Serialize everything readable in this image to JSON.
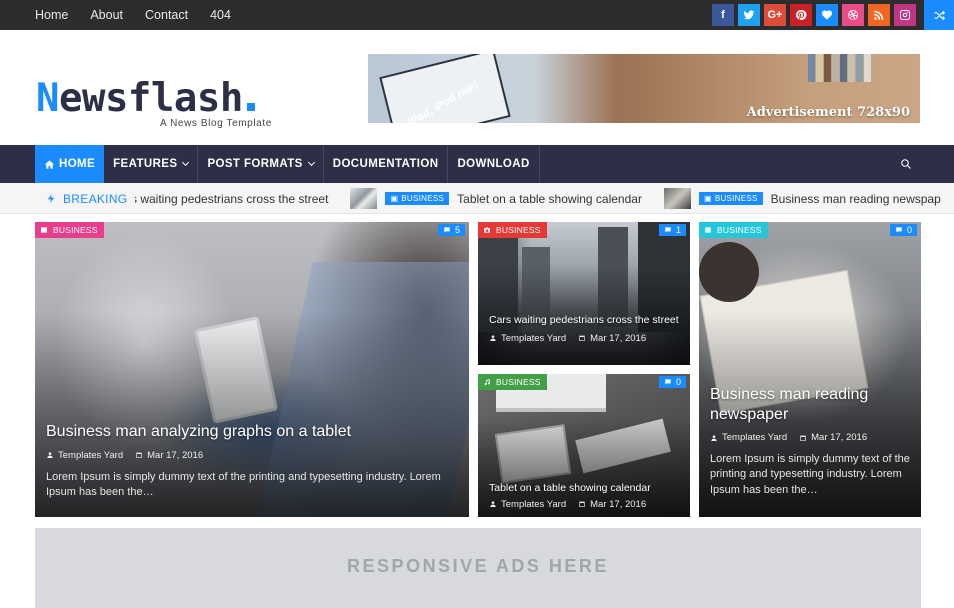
{
  "topnav": {
    "items": [
      "Home",
      "About",
      "Contact",
      "404"
    ]
  },
  "socials": [
    {
      "icon": "facebook-icon",
      "glyph": "f",
      "color": "#3b5998"
    },
    {
      "icon": "twitter-icon",
      "glyph": "t",
      "color": "#1da1f2"
    },
    {
      "icon": "google-plus-icon",
      "glyph": "G+",
      "color": "#dd4b39"
    },
    {
      "icon": "pinterest-icon",
      "glyph": "P",
      "color": "#cb2027"
    },
    {
      "icon": "heart-icon",
      "glyph": "♥",
      "color": "#1a8cff"
    },
    {
      "icon": "dribbble-icon",
      "glyph": "◎",
      "color": "#ea4c89"
    },
    {
      "icon": "rss-icon",
      "glyph": "◉",
      "color": "#f26522"
    },
    {
      "icon": "instagram-icon",
      "glyph": "◻",
      "color": "#c13584"
    }
  ],
  "logo": {
    "first": "N",
    "rest": "ewsflash",
    "tagline": "A News Blog Template"
  },
  "ad": {
    "text": "Advertisement 728x90",
    "ipad_label": "iPad, iPod mini"
  },
  "mainnav": {
    "home": "HOME",
    "features": "FEATURES",
    "post_formats": "POST FORMATS",
    "documentation": "DOCUMENTATION",
    "download": "DOWNLOAD"
  },
  "ticker": {
    "label": "BREAKING",
    "items": [
      {
        "title": "s waiting pedestrians cross the street"
      },
      {
        "badge": "BUSINESS",
        "title": "Tablet on a table showing calendar"
      },
      {
        "badge": "BUSINESS",
        "title": "Business man reading newspap"
      }
    ]
  },
  "posts": [
    {
      "category": "BUSINESS",
      "category_color": "#e83e8c",
      "comments": "5",
      "title": "Business man analyzing graphs on a tablet",
      "author": "Templates Yard",
      "date": "Mar 17, 2016",
      "excerpt": "Lorem Ipsum is simply dummy text of the printing and typesetting industry. Lorem Ipsum has been the…"
    },
    {
      "category": "BUSINESS",
      "category_color": "#e53935",
      "comments": "1",
      "title": "Cars waiting pedestrians cross the street",
      "author": "Templates Yard",
      "date": "Mar 17, 2016"
    },
    {
      "category": "BUSINESS",
      "category_color": "#43a047",
      "comments": "0",
      "title": "Tablet on a table showing calendar",
      "author": "Templates Yard",
      "date": "Mar 17, 2016"
    },
    {
      "category": "BUSINESS",
      "category_color": "#26c6da",
      "comments": "0",
      "title": "Business man reading newspaper",
      "author": "Templates Yard",
      "date": "Mar 17, 2016",
      "excerpt": "Lorem Ipsum is simply dummy text of the printing and typesetting industry. Lorem Ipsum has been the…"
    }
  ],
  "ads": {
    "responsive": "RESPONSIVE ADS HERE"
  }
}
